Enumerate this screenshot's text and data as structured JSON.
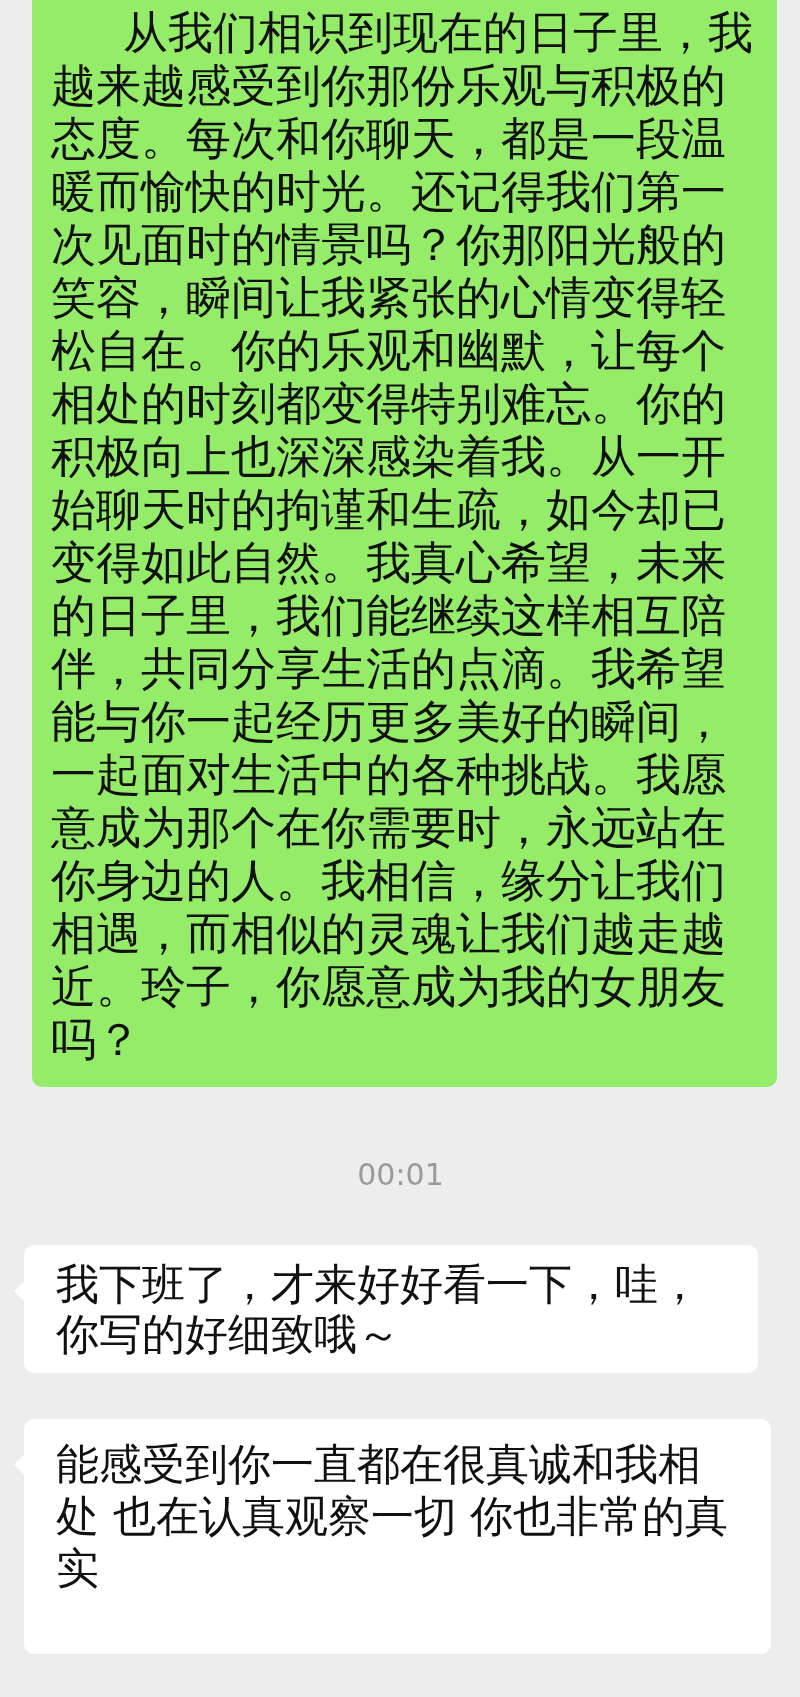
{
  "messages": [
    {
      "kind": "sent",
      "text": "从我们相识到现在的日子里，我越来越感受到你那份乐观与积极的态度。每次和你聊天，都是一段温暖而愉快的时光。还记得我们第一次见面时的情景吗？你那阳光般的笑容，瞬间让我紧张的心情变得轻松自在。你的乐观和幽默，让每个相处的时刻都变得特别难忘。你的积极向上也深深感染着我。从一开始聊天时的拘谨和生疏，如今却已变得如此自然。我真心希望，未来的日子里，我们能继续这样相互陪伴，共同分享生活的点滴。我希望能与你一起经历更多美好的瞬间，一起面对生活中的各种挑战。我愿意成为那个在你需要时，永远站在你身边的人。我相信，缘分让我们相遇，而相似的灵魂让我们越走越近。玲子，你愿意成为我的女朋友吗？"
    },
    {
      "kind": "time",
      "text": "00:01"
    },
    {
      "kind": "received",
      "text": "我下班了，才来好好看一下，哇，你写的好细致哦～"
    },
    {
      "kind": "received",
      "text": "能感受到你一直都在很真诚和我相处 也在认真观察一切 你也非常的真实"
    }
  ]
}
